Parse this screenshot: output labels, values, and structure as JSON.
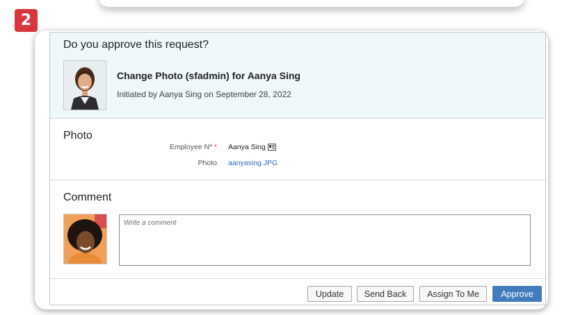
{
  "step_badge": "2",
  "request": {
    "question": "Do you approve this request?",
    "title": "Change Photo (sfadmin) for Aanya Sing",
    "subtitle": "Initiated by Aanya Sing on September 28, 2022"
  },
  "photo_section": {
    "title": "Photo",
    "fields": [
      {
        "label": "Employee Nº",
        "required": true,
        "value": "Aanya Sing",
        "icon": "employee-card-icon"
      },
      {
        "label": "Photo",
        "required": false,
        "value": "aanyasing.JPG"
      }
    ]
  },
  "comment_section": {
    "title": "Comment",
    "placeholder": "Write a comment"
  },
  "buttons": {
    "update": "Update",
    "send_back": "Send Back",
    "assign_to_me": "Assign To Me",
    "approve": "Approve"
  },
  "colors": {
    "badge": "#d9363e",
    "header_bg": "#eef7f9",
    "link": "#2a6cb8",
    "primary_button": "#427cbc"
  }
}
